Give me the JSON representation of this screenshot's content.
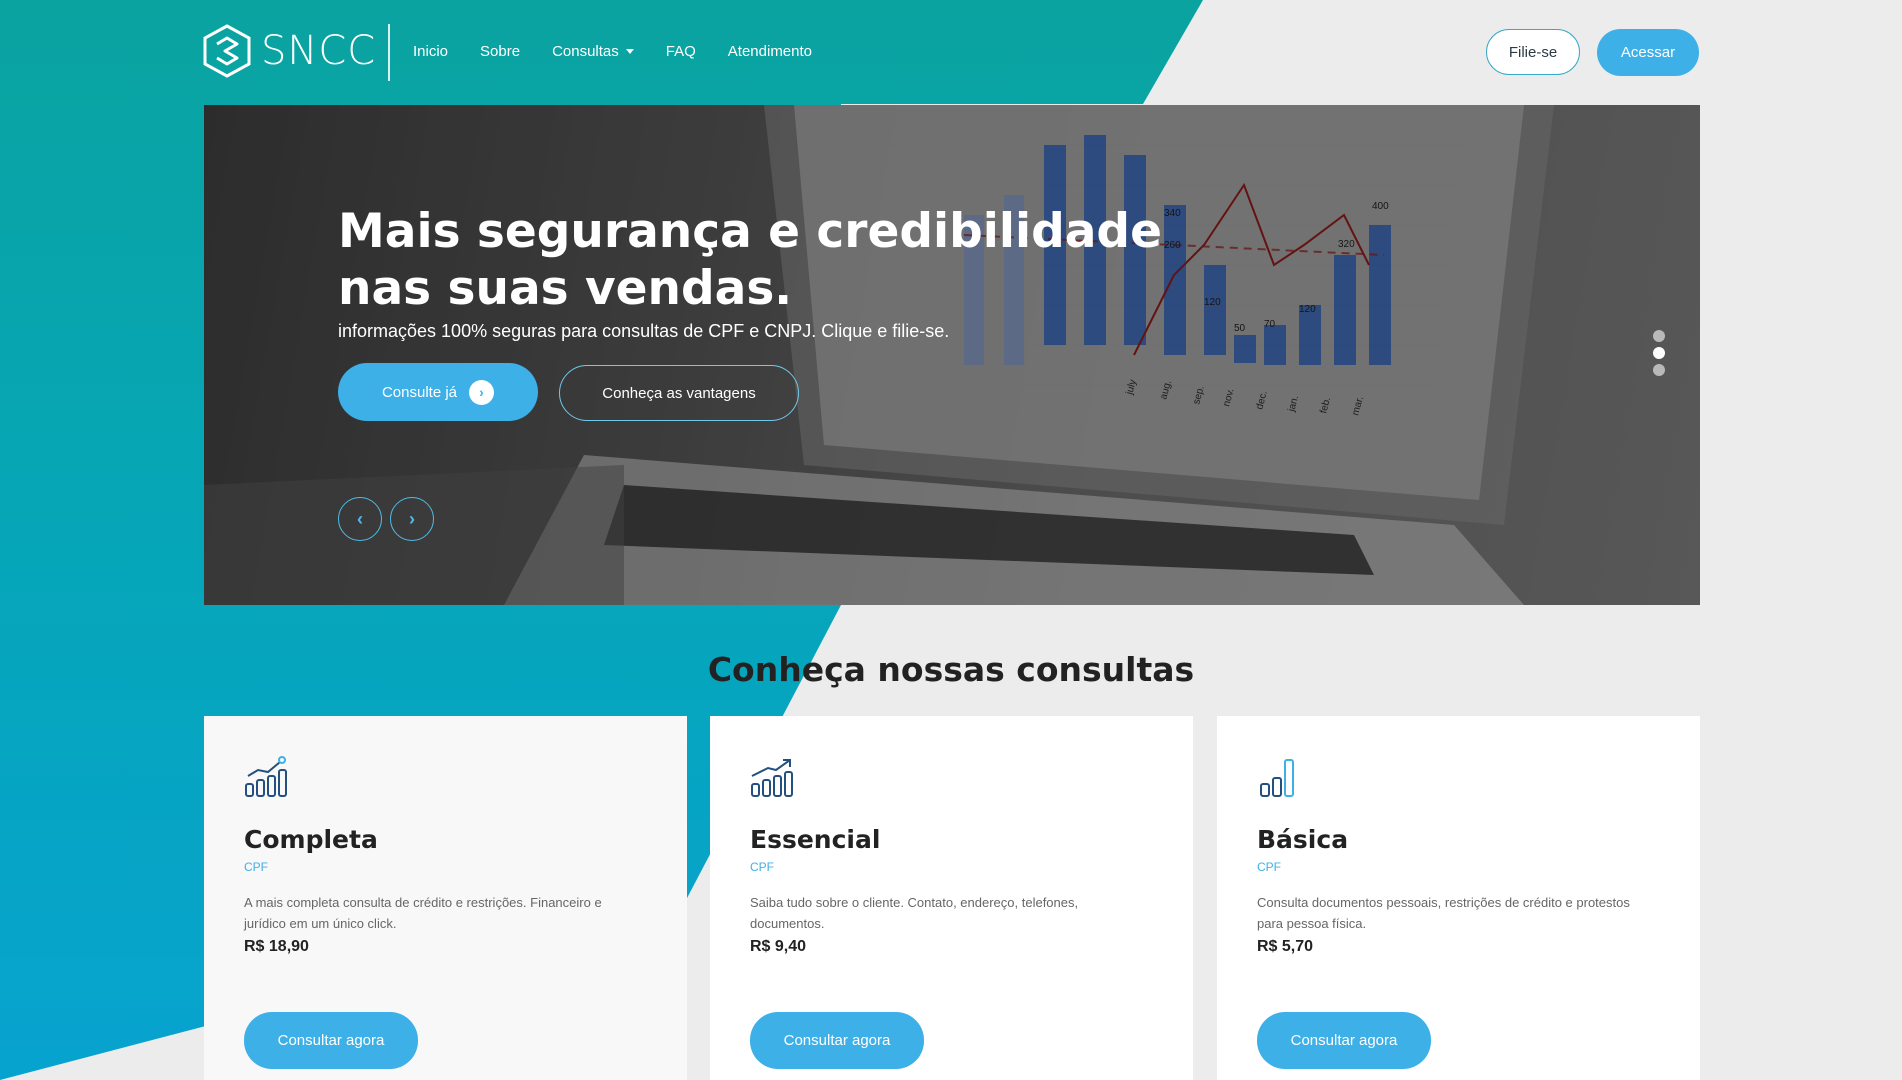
{
  "brand": {
    "name": "SNCC"
  },
  "nav": [
    {
      "label": "Inicio"
    },
    {
      "label": "Sobre"
    },
    {
      "label": "Consultas",
      "dropdown": true
    },
    {
      "label": "FAQ"
    },
    {
      "label": "Atendimento"
    }
  ],
  "header_actions": {
    "filie_label": "Filie-se",
    "acessar_label": "Acessar"
  },
  "hero": {
    "title": "Mais segurança e credibilidade nas suas vendas.",
    "subtitle": "informações 100% seguras para consultas de CPF e CNPJ. Clique e filie-se.",
    "primary_button": "Consulte já",
    "secondary_button": "Conheça as vantagens",
    "slides": 3,
    "active_slide": 2,
    "chart_labels": [
      "july",
      "aug.",
      "sep.",
      "nov.",
      "dec.",
      "jan.",
      "feb.",
      "mar."
    ],
    "chart_values": [
      "120",
      "50",
      "70",
      "120",
      "260",
      "340",
      "320",
      "400"
    ]
  },
  "section": {
    "title": "Conheça nossas consultas"
  },
  "cards": [
    {
      "title": "Completa",
      "tag": "CPF",
      "description": "A mais completa consulta de crédito e restrições. Financeiro e jurídico em um único click.",
      "price": "R$ 18,90",
      "button": "Consultar agora",
      "icon": "chart-growth-icon"
    },
    {
      "title": "Essencial",
      "tag": "CPF",
      "description": "Saiba tudo sobre o cliente. Contato, endereço, telefones, documentos.",
      "price": "R$ 9,40",
      "button": "Consultar agora",
      "icon": "chart-trend-icon"
    },
    {
      "title": "Básica",
      "tag": "CPF",
      "description": "Consulta documentos pessoais, restrições de crédito e protestos para pessoa física.",
      "price": "R$ 5,70",
      "button": "Consultar agora",
      "icon": "bar-chart-icon"
    }
  ],
  "colors": {
    "primary": "#3db0e8",
    "teal": "#0aa3a0",
    "background": "#ececec"
  }
}
